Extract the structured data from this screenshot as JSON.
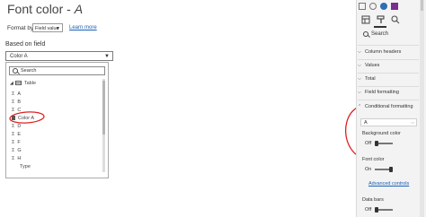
{
  "dialog": {
    "title_prefix": "Font color - ",
    "title_field": "A",
    "format_by_label": "Format by",
    "format_by_value": "Field value",
    "learn_more": "Learn more",
    "based_on_label": "Based on field",
    "field_value": "Color A",
    "search_placeholder": "Search",
    "tree": {
      "table_label": "Table",
      "items": [
        {
          "label": "A",
          "kind": "sigma"
        },
        {
          "label": "B",
          "kind": "sigma"
        },
        {
          "label": "C",
          "kind": "sigma"
        },
        {
          "label": "Color A",
          "kind": "calc"
        },
        {
          "label": "D",
          "kind": "sigma"
        },
        {
          "label": "E",
          "kind": "sigma"
        },
        {
          "label": "F",
          "kind": "sigma"
        },
        {
          "label": "G",
          "kind": "sigma"
        },
        {
          "label": "H",
          "kind": "sigma"
        },
        {
          "label": "Type",
          "kind": "none"
        }
      ]
    }
  },
  "pane": {
    "search_placeholder": "Search",
    "sections": [
      {
        "label": "Column headers"
      },
      {
        "label": "Values"
      },
      {
        "label": "Total"
      },
      {
        "label": "Field formatting"
      },
      {
        "label": "Conditional formatting",
        "expanded": true
      }
    ],
    "cf_field": "A",
    "background_color_label": "Background color",
    "background_toggle": "Off",
    "font_color_label": "Font color",
    "font_toggle": "On",
    "advanced_controls": "Advanced controls",
    "data_bars_label": "Data bars",
    "data_bars_toggle": "Off"
  },
  "colors": {
    "annotation": "#e02020",
    "link": "#1a5fb4",
    "pane_bg": "#f3f3f3"
  }
}
